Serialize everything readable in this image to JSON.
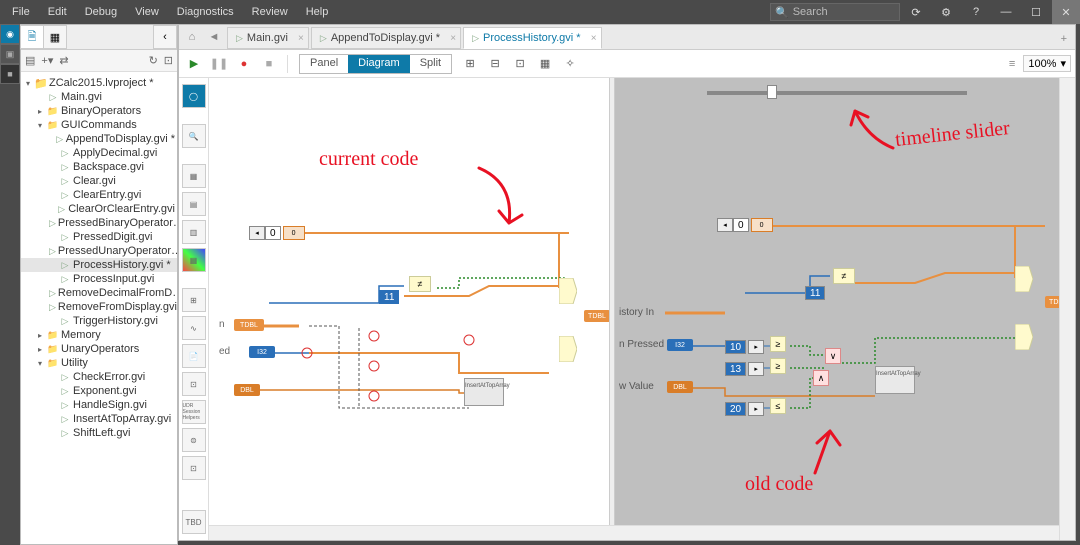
{
  "menu": {
    "file": "File",
    "edit": "Edit",
    "debug": "Debug",
    "view": "View",
    "diag": "Diagnostics",
    "review": "Review",
    "help": "Help"
  },
  "search": {
    "placeholder": "Search"
  },
  "project": {
    "root": "ZCalc2015.lvproject *",
    "items": [
      {
        "l": "Main.gvi",
        "d": 1,
        "i": "vi"
      },
      {
        "l": "BinaryOperators",
        "d": 1,
        "i": "folder",
        "t": "▸"
      },
      {
        "l": "GUICommands",
        "d": 1,
        "i": "folder",
        "t": "▾",
        "open": true
      },
      {
        "l": "AppendToDisplay.gvi *",
        "d": 2,
        "i": "vi"
      },
      {
        "l": "ApplyDecimal.gvi",
        "d": 2,
        "i": "vi"
      },
      {
        "l": "Backspace.gvi",
        "d": 2,
        "i": "vi"
      },
      {
        "l": "Clear.gvi",
        "d": 2,
        "i": "vi"
      },
      {
        "l": "ClearEntry.gvi",
        "d": 2,
        "i": "vi"
      },
      {
        "l": "ClearOrClearEntry.gvi",
        "d": 2,
        "i": "vi"
      },
      {
        "l": "PressedBinaryOperator…",
        "d": 2,
        "i": "vi"
      },
      {
        "l": "PressedDigit.gvi",
        "d": 2,
        "i": "vi"
      },
      {
        "l": "PressedUnaryOperator…",
        "d": 2,
        "i": "vi"
      },
      {
        "l": "ProcessHistory.gvi *",
        "d": 2,
        "i": "vi",
        "sel": true
      },
      {
        "l": "ProcessInput.gvi",
        "d": 2,
        "i": "vi"
      },
      {
        "l": "RemoveDecimalFromD…",
        "d": 2,
        "i": "vi"
      },
      {
        "l": "RemoveFromDisplay.gvi",
        "d": 2,
        "i": "vi"
      },
      {
        "l": "TriggerHistory.gvi",
        "d": 2,
        "i": "vi"
      },
      {
        "l": "Memory",
        "d": 1,
        "i": "folder",
        "t": "▸"
      },
      {
        "l": "UnaryOperators",
        "d": 1,
        "i": "folder",
        "t": "▸"
      },
      {
        "l": "Utility",
        "d": 1,
        "i": "folder",
        "t": "▾",
        "open": true
      },
      {
        "l": "CheckError.gvi",
        "d": 2,
        "i": "vi"
      },
      {
        "l": "Exponent.gvi",
        "d": 2,
        "i": "vi"
      },
      {
        "l": "HandleSign.gvi",
        "d": 2,
        "i": "vi"
      },
      {
        "l": "InsertAtTopArray.gvi",
        "d": 2,
        "i": "vi"
      },
      {
        "l": "ShiftLeft.gvi",
        "d": 2,
        "i": "vi"
      }
    ]
  },
  "tabs": [
    {
      "l": "Main.gvi"
    },
    {
      "l": "AppendToDisplay.gvi *"
    },
    {
      "l": "ProcessHistory.gvi *",
      "active": true
    }
  ],
  "views": {
    "panel": "Panel",
    "diagram": "Diagram",
    "split": "Split"
  },
  "zoom": "100%",
  "annotation": {
    "current": "current code",
    "old": "old code",
    "slider": "timeline slider"
  },
  "diagram_left": {
    "const0": "0",
    "const11": "11",
    "t_i32": "I32",
    "t_dbl": "DBL",
    "t_tdbl": "TDBL",
    "n_label": "n",
    "ed_label": "ed",
    "subvi": "InsertAtTopArray"
  },
  "diagram_right": {
    "const0": "0",
    "const11": "11",
    "const10": "10",
    "const13": "13",
    "const20": "20",
    "t_i32": "I32",
    "t_dbl": "DBL",
    "t_tdbl": "TDBL",
    "in_label": "istory In",
    "pressed_label": "n Pressed",
    "val_label": "w Value",
    "subvi": "InsertAtTopArray"
  },
  "palette_tbd": "TBD",
  "palette_udr": "UDR\nSession\nHelpers"
}
